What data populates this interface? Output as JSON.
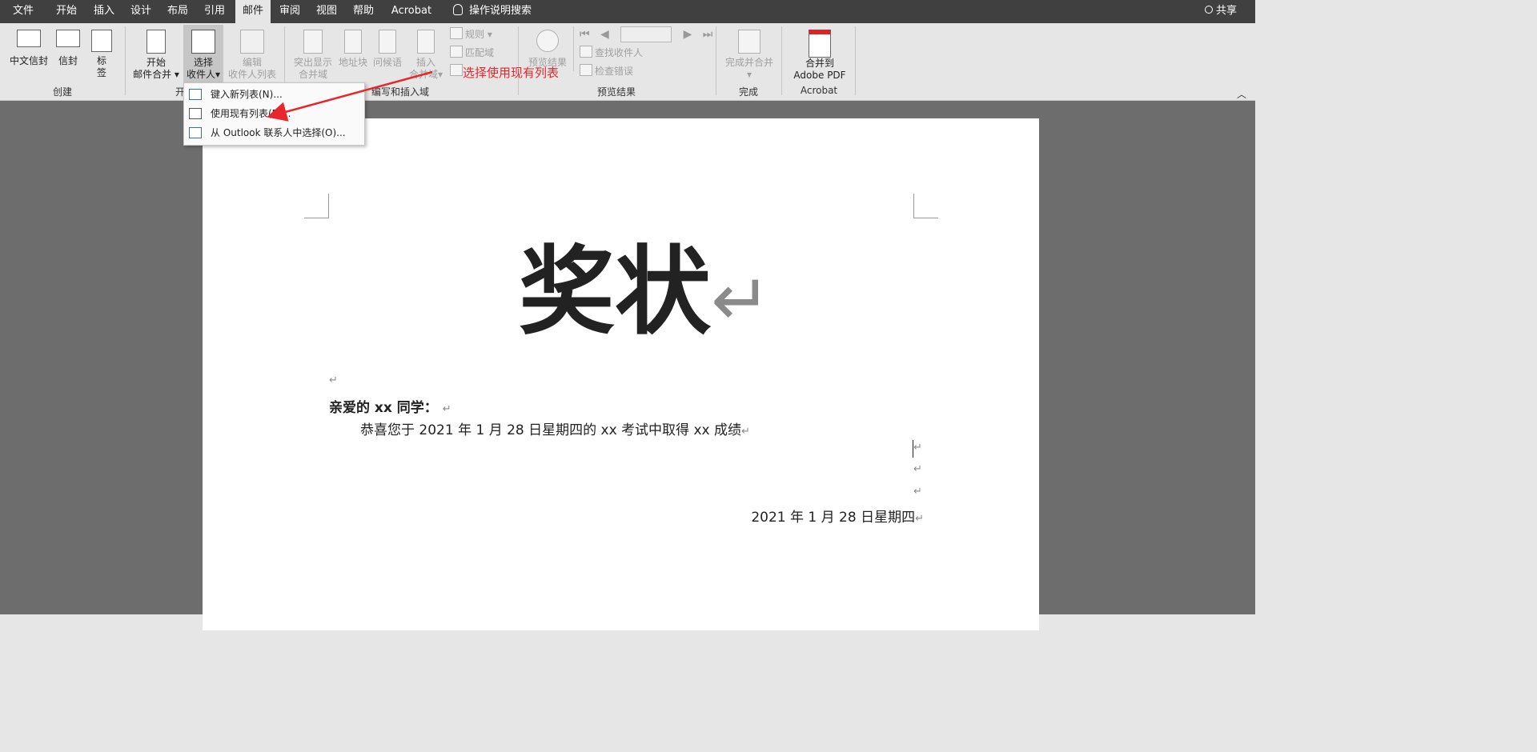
{
  "tabs": [
    "文件",
    "开始",
    "插入",
    "设计",
    "布局",
    "引用",
    "邮件",
    "审阅",
    "视图",
    "帮助",
    "Acrobat"
  ],
  "active_tab": "邮件",
  "search_label": "操作说明搜索",
  "share_label": "共享",
  "groups": {
    "create": {
      "label": "创建",
      "buttons": [
        "中文信封",
        "信封",
        "标签"
      ]
    },
    "start": {
      "label": "开",
      "start_btn": [
        "开始",
        "邮件合并"
      ],
      "select_btn": [
        "选择",
        "收件人"
      ],
      "edit_btn": [
        "编辑",
        "收件人列表"
      ]
    },
    "write": {
      "label": "编写和插入域",
      "highlight": [
        "突出显示",
        "合并域"
      ],
      "address": "地址块",
      "greeting": "问候语",
      "insert": [
        "插入",
        "合并域"
      ],
      "rules": "规则",
      "match": "匹配域"
    },
    "preview": {
      "label": "预览结果",
      "preview_btn": "预览结果",
      "find": "查找收件人",
      "check": "检查错误"
    },
    "finish": {
      "label": "完成",
      "btn": [
        "完成并合并"
      ]
    },
    "acrobat": {
      "label": "Acrobat",
      "btn": [
        "合并到",
        "Adobe PDF"
      ]
    }
  },
  "dropdown": {
    "items": [
      "键入新列表(N)...",
      "使用现有列表(E)...",
      "从 Outlook 联系人中选择(O)..."
    ]
  },
  "annotation": "选择使用现有列表",
  "document": {
    "title": "奖状",
    "greeting": "亲爱的 xx 同学：",
    "body": "恭喜您于 2021 年 1 月 28 日星期四的 xx 考试中取得 xx 成绩",
    "date": "2021 年 1 月 28 日星期四",
    "para_mark": "↵"
  },
  "colors": {
    "tabbar": "#404040",
    "annotation": "#e8262b",
    "doc_bg": "#6d6d6d"
  }
}
